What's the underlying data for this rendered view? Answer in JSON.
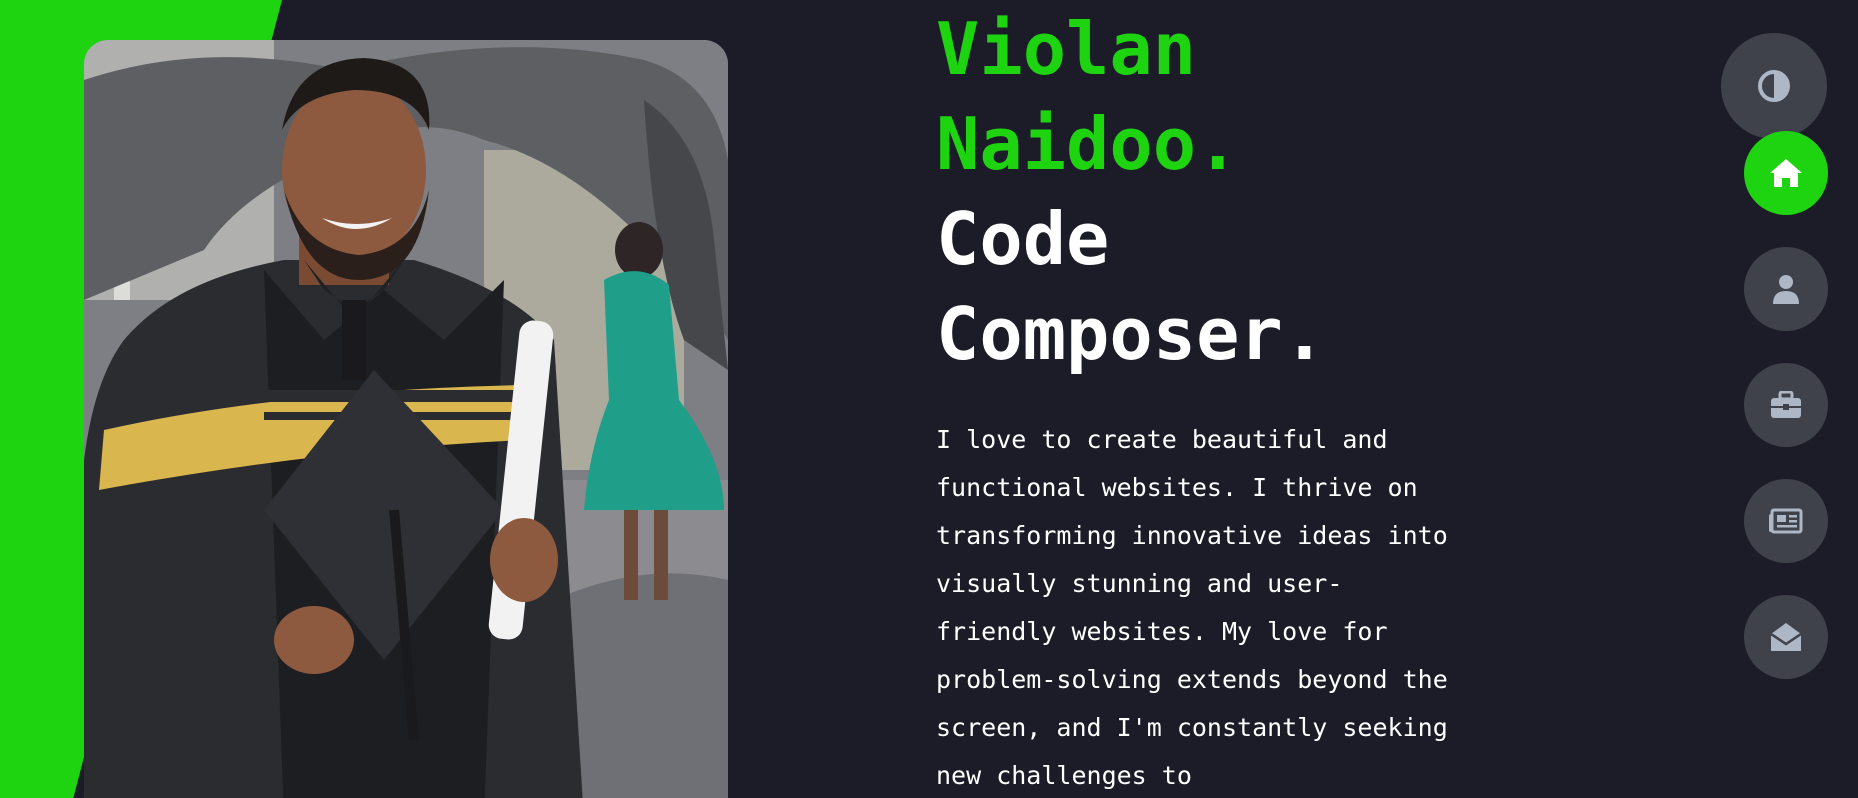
{
  "hero": {
    "name_line1": "Violan",
    "name_line2": "Naidoo.",
    "tagline_line1": "Code",
    "tagline_line2": "Composer.",
    "bio": "I love to create beautiful and functional websites. I thrive on transforming innovative ideas into visually stunning and user-friendly websites. My love for problem-solving extends beyond the screen, and I'm constantly seeking new challenges to"
  },
  "nav": {
    "items": [
      {
        "icon": "theme-toggle-icon"
      },
      {
        "icon": "home-icon",
        "active": true
      },
      {
        "icon": "user-icon"
      },
      {
        "icon": "briefcase-icon"
      },
      {
        "icon": "newspaper-icon"
      },
      {
        "icon": "envelope-open-icon"
      }
    ]
  },
  "colors": {
    "accent": "#1ed30f",
    "background": "#1b1c28",
    "nav_button": "#3f424b",
    "icon": "#aeb7c6"
  }
}
